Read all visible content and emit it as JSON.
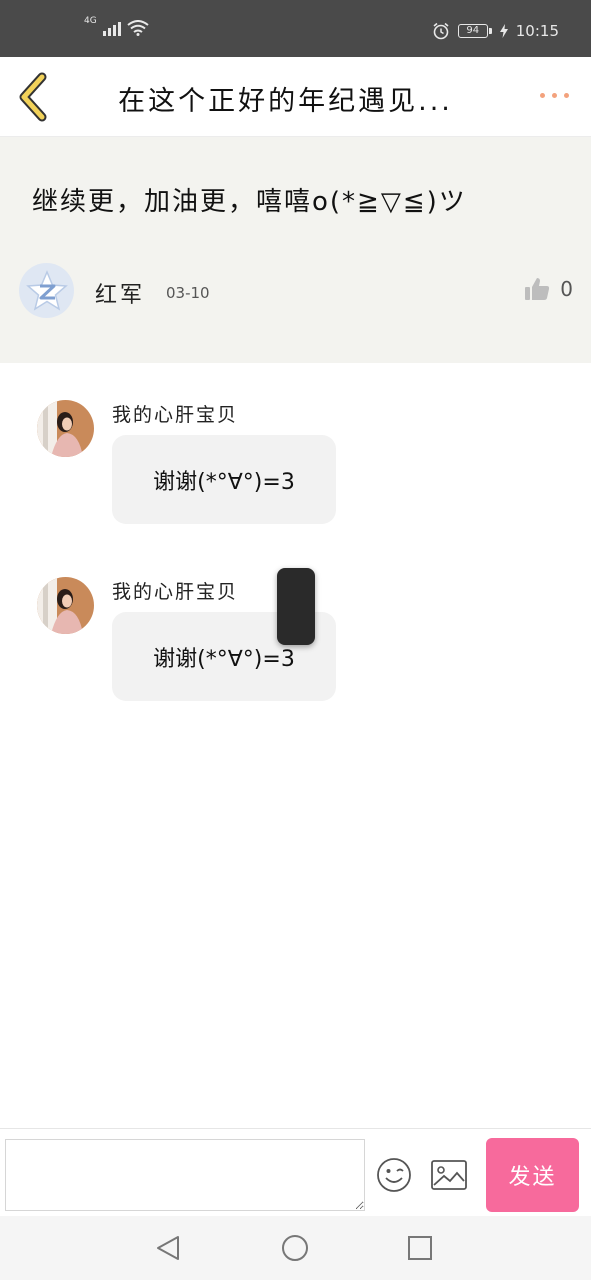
{
  "status_bar": {
    "network": "4G",
    "battery": "94",
    "time": "10:15"
  },
  "header": {
    "title": "在这个正好的年纪遇见..."
  },
  "post": {
    "text": "继续更，加油更，嘻嘻o(*≧▽≦)ツ",
    "author": "红军",
    "date": "03-10",
    "likes": "0"
  },
  "replies": [
    {
      "name": "我的心肝宝贝",
      "text": "谢谢(*°∀°)=3"
    },
    {
      "name": "我的心肝宝贝",
      "text": "谢谢(*°∀°)=3"
    }
  ],
  "input_bar": {
    "placeholder": "",
    "send_label": "发送"
  },
  "icons": {
    "back": "chevron-left-icon",
    "more": "more-dots-icon",
    "like": "thumbs-up-icon",
    "emoji": "smiley-icon",
    "image": "image-icon"
  },
  "colors": {
    "accent": "#f76a9c",
    "back_arrow": "#f2d25a",
    "more_dots": "#f3a27d",
    "post_bg": "#f3f3ef"
  }
}
